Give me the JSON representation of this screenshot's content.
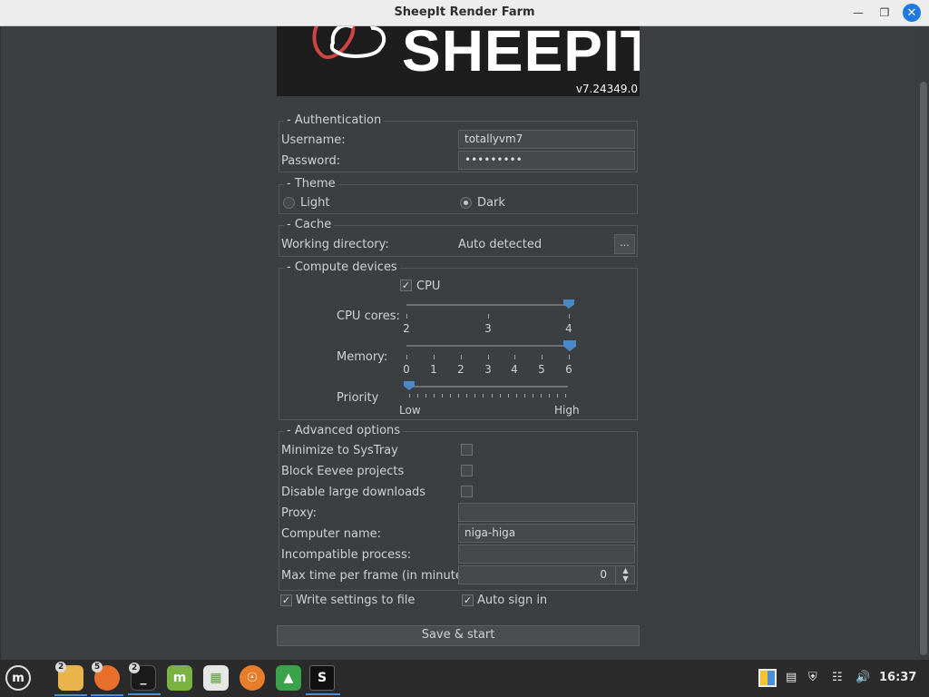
{
  "window": {
    "title": "SheepIt Render Farm"
  },
  "logo": {
    "wordmark": "SHEEPIT",
    "version": "v7.24349.0"
  },
  "authentication": {
    "legend": "- Authentication",
    "username_label": "Username:",
    "username_value": "totallyvm7",
    "password_label": "Password:",
    "password_value": "•••••••••"
  },
  "theme": {
    "legend": "- Theme",
    "light": "Light",
    "dark": "Dark",
    "selected": "Dark"
  },
  "cache": {
    "legend": "- Cache",
    "working_dir_label": "Working directory:",
    "working_dir_value": "Auto detected",
    "browse_label": "..."
  },
  "compute": {
    "legend": "- Compute devices",
    "cpu_label": "CPU",
    "cpu_checked": true,
    "cpu_cores_label": "CPU cores:",
    "cpu_core_ticks": [
      "2",
      "3",
      "4"
    ],
    "cpu_cores_value": 4,
    "memory_label": "Memory:",
    "memory_ticks": [
      "0",
      "1",
      "2",
      "3",
      "4",
      "5",
      "6"
    ],
    "memory_value": 6,
    "priority_label": "Priority",
    "priority_low": "Low",
    "priority_high": "High",
    "priority_value": 0
  },
  "advanced": {
    "legend": "- Advanced options",
    "minimize_label": "Minimize to SysTray",
    "block_eevee_label": "Block Eevee projects",
    "disable_large_label": "Disable large downloads",
    "proxy_label": "Proxy:",
    "proxy_value": "",
    "computer_name_label": "Computer name:",
    "computer_name_value": "niga-higa",
    "incompatible_label": "Incompatible process:",
    "incompatible_value": "",
    "max_time_label": "Max time per frame (in minute):",
    "max_time_value": "0",
    "write_settings_label": "Write settings to file",
    "auto_signin_label": "Auto sign in"
  },
  "save_button": "Save & start",
  "taskbar": {
    "badges": {
      "files": "2",
      "firefox": "5",
      "terminal": "2"
    },
    "clock": "16:37",
    "sheepit_letter": "S"
  },
  "colors": {
    "accent": "#4a88c7",
    "background": "#3c3f41",
    "taskbar": "#2b2b2b"
  }
}
